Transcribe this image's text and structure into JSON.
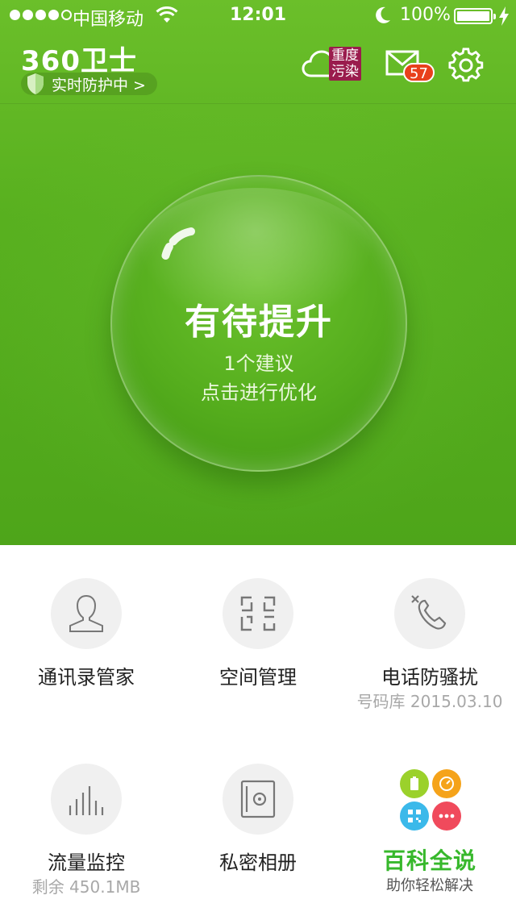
{
  "status_bar": {
    "carrier": "中国移动",
    "time": "12:01",
    "battery": "100%"
  },
  "header": {
    "logo": "360卫士",
    "protect_label": "实时防护中 >",
    "cloud_badge_line1": "重度",
    "cloud_badge_line2": "污染",
    "mail_count": "57"
  },
  "bubble": {
    "title": "有待提升",
    "line1": "1个建议",
    "line2": "点击进行优化"
  },
  "grid": {
    "contacts": {
      "label": "通讯录管家"
    },
    "space": {
      "label": "空间管理"
    },
    "phone": {
      "label": "电话防骚扰",
      "sub": "号码库 2015.03.10"
    },
    "traffic": {
      "label": "流量监控",
      "sub": "剩余 450.1MB"
    },
    "album": {
      "label": "私密相册"
    },
    "wiki": {
      "label": "百科全说",
      "sub": "助你轻松解决"
    }
  },
  "colors": {
    "primary_green": "#55ad1d",
    "badge_purple": "#9a1c4d",
    "mail_badge_red": "#e8401c",
    "wiki_green": "#37b82c"
  }
}
